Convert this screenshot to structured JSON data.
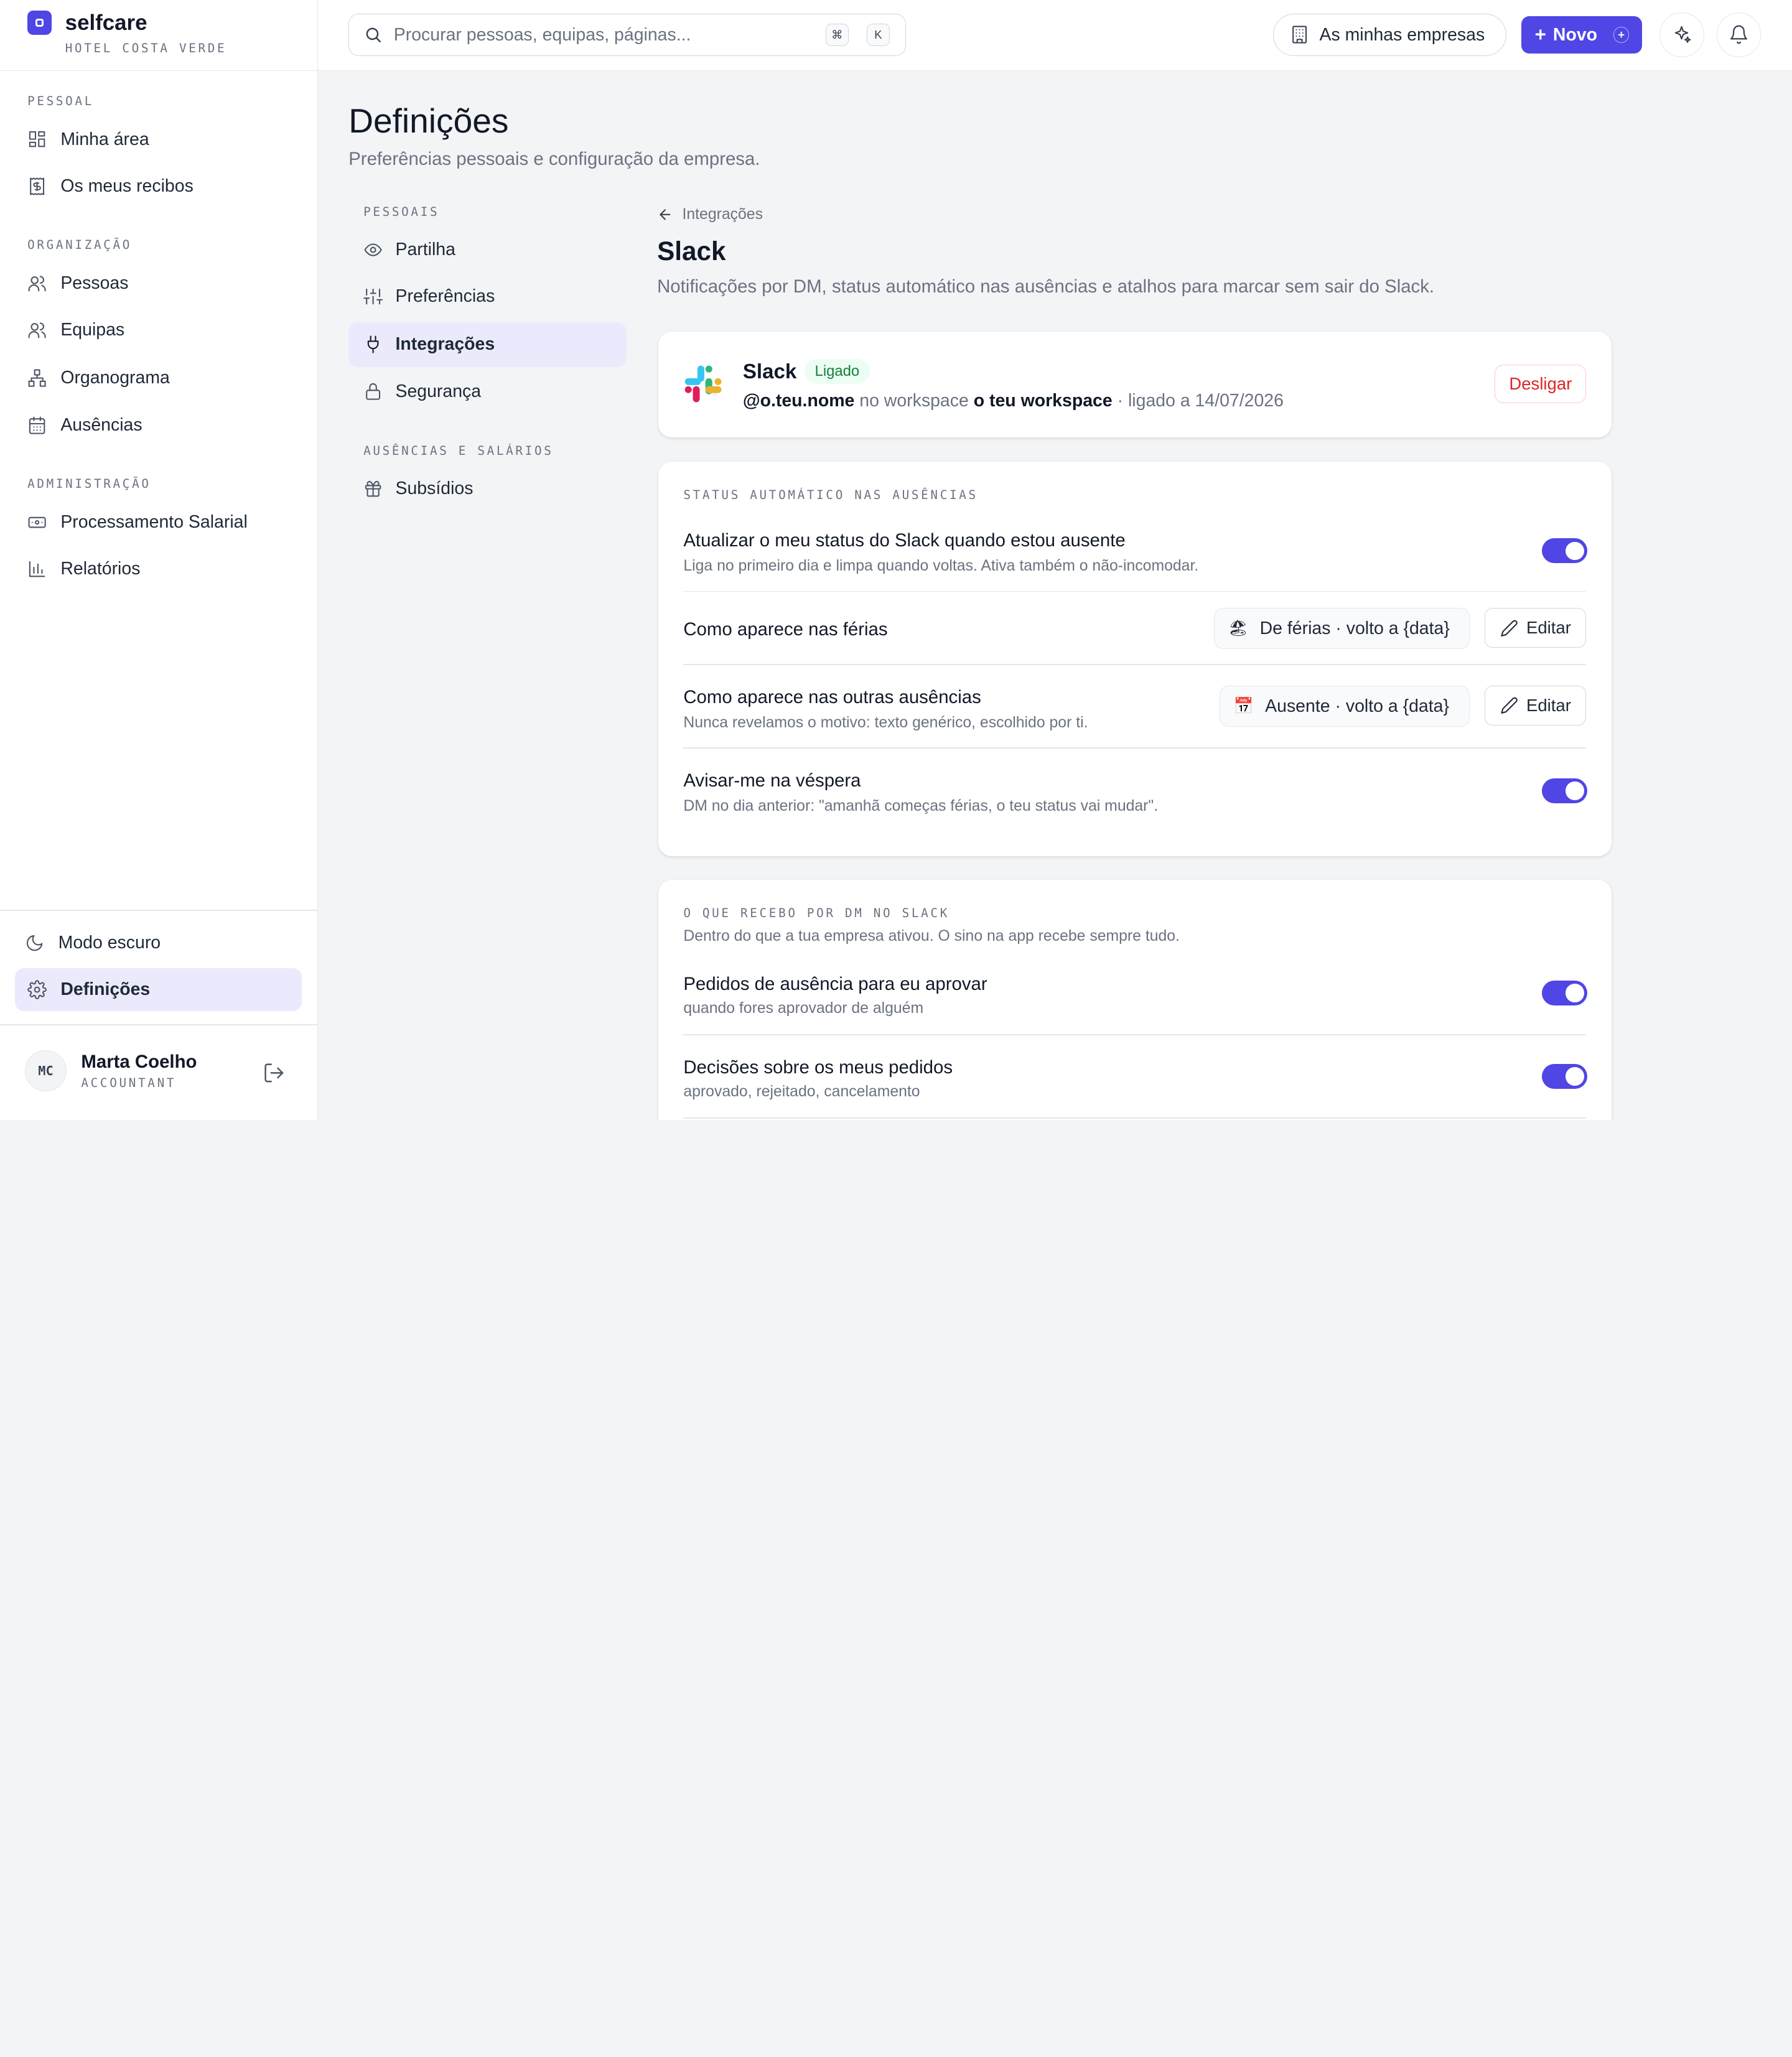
{
  "brand": {
    "name": "selfcare",
    "company": "HOTEL COSTA VERDE"
  },
  "sidebar": {
    "sections": [
      {
        "title": "PESSOAL",
        "items": [
          {
            "label": "Minha área",
            "icon": "dashboard-icon"
          },
          {
            "label": "Os meus recibos",
            "icon": "receipt-icon"
          }
        ]
      },
      {
        "title": "ORGANIZAÇÃO",
        "items": [
          {
            "label": "Pessoas",
            "icon": "users-icon"
          },
          {
            "label": "Equipas",
            "icon": "team-icon"
          },
          {
            "label": "Organograma",
            "icon": "org-chart-icon"
          },
          {
            "label": "Ausências",
            "icon": "calendar-icon"
          }
        ]
      },
      {
        "title": "ADMINISTRAÇÃO",
        "items": [
          {
            "label": "Processamento Salarial",
            "icon": "banknote-icon"
          },
          {
            "label": "Relatórios",
            "icon": "bar-chart-icon"
          }
        ]
      }
    ],
    "dark_mode_label": "Modo escuro",
    "settings_label": "Definições",
    "user": {
      "initials": "MC",
      "name": "Marta Coelho",
      "role": "ACCOUNTANT"
    }
  },
  "topbar": {
    "search_placeholder": "Procurar pessoas, equipas, páginas...",
    "shortcut_keys": [
      "⌘",
      "K"
    ],
    "companies_label": "As minhas empresas",
    "new_label": "Novo"
  },
  "page": {
    "title": "Definições",
    "subtitle": "Preferências pessoais e configuração da empresa."
  },
  "settings_nav": {
    "sections": [
      {
        "title": "PESSOAIS",
        "items": [
          {
            "label": "Partilha",
            "icon": "eye-icon"
          },
          {
            "label": "Preferências",
            "icon": "sliders-icon"
          },
          {
            "label": "Integrações",
            "icon": "plug-icon",
            "active": true
          },
          {
            "label": "Segurança",
            "icon": "lock-icon"
          }
        ]
      },
      {
        "title": "AUSÊNCIAS E SALÁRIOS",
        "items": [
          {
            "label": "Subsídios",
            "icon": "gift-icon"
          }
        ]
      }
    ]
  },
  "integration": {
    "back_label": "Integrações",
    "title": "Slack",
    "description": "Notificações por DM, status automático nas ausências e atalhos para marcar sem sair do Slack.",
    "connection": {
      "name": "Slack",
      "status": "Ligado",
      "handle": "@o.teu.nome",
      "workspace_prefix": " no workspace ",
      "workspace": "o teu workspace",
      "connected_text": " · ligado a 14/07/2026",
      "disconnect_label": "Desligar"
    },
    "auto_status": {
      "section_title": "STATUS AUTOMÁTICO NAS AUSÊNCIAS",
      "update_title": "Atualizar o meu status do Slack quando estou ausente",
      "update_desc": "Liga no primeiro dia e limpa quando voltas. Ativa também o não-incomodar.",
      "update_enabled": true,
      "vacation_title": "Como aparece nas férias",
      "vacation_emoji": "🏖",
      "vacation_status": "De férias · volto a {data}",
      "other_title": "Como aparece nas outras ausências",
      "other_desc": "Nunca revelamos o motivo: texto genérico, escolhido por ti.",
      "other_emoji": "📅",
      "other_status": "Ausente · volto a {data}",
      "edit_label": "Editar",
      "eve_title": "Avisar-me na véspera",
      "eve_desc": "DM no dia anterior: \"amanhã começas férias, o teu status vai mudar\".",
      "eve_enabled": true
    },
    "dm": {
      "section_title": "O QUE RECEBO POR DM NO SLACK",
      "section_desc": "Dentro do que a tua empresa ativou. O sino na app recebe sempre tudo.",
      "items": [
        {
          "title": "Pedidos de ausência para eu aprovar",
          "desc": "quando fores aprovador de alguém",
          "enabled": true
        },
        {
          "title": "Decisões sobre os meus pedidos",
          "desc": "aprovado, rejeitado, cancelamento",
          "enabled": true
        }
      ]
    }
  },
  "colors": {
    "accent": "#4f46e5",
    "accent_soft": "#ebeafd",
    "success": "#15803d",
    "danger": "#dc2626"
  }
}
